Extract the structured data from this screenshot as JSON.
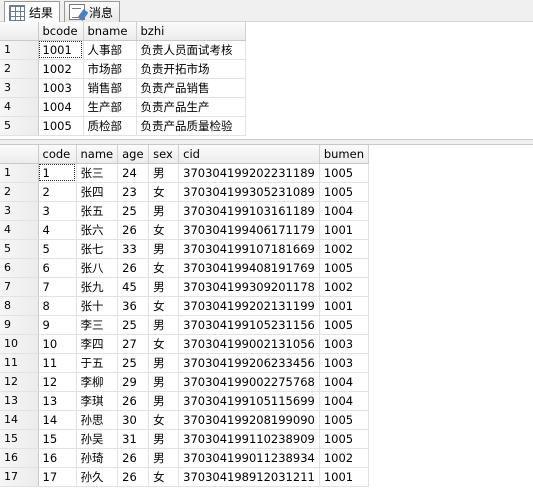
{
  "tabs": [
    {
      "label": "结果",
      "icon": "grid-icon",
      "active": true
    },
    {
      "label": "消息",
      "icon": "messages-icon",
      "active": false
    }
  ],
  "departments": {
    "columns": [
      "bcode",
      "bname",
      "bzhi"
    ],
    "rows": [
      [
        "1001",
        "人事部",
        "负责人员面试考核"
      ],
      [
        "1002",
        "市场部",
        "负责开拓市场"
      ],
      [
        "1003",
        "销售部",
        "负责产品销售"
      ],
      [
        "1004",
        "生产部",
        "负责产品生产"
      ],
      [
        "1005",
        "质检部",
        "负责产品质量检验"
      ]
    ]
  },
  "employees": {
    "columns": [
      "code",
      "name",
      "age",
      "sex",
      "cid",
      "bumen"
    ],
    "rows": [
      [
        "1",
        "张三",
        "24",
        "男",
        "370304199202231189",
        "1005"
      ],
      [
        "2",
        "张四",
        "23",
        "女",
        "370304199305231089",
        "1005"
      ],
      [
        "3",
        "张五",
        "25",
        "男",
        "370304199103161189",
        "1004"
      ],
      [
        "4",
        "张六",
        "26",
        "女",
        "370304199406171179",
        "1001"
      ],
      [
        "5",
        "张七",
        "33",
        "男",
        "370304199107181669",
        "1002"
      ],
      [
        "6",
        "张八",
        "26",
        "女",
        "370304199408191769",
        "1005"
      ],
      [
        "7",
        "张九",
        "45",
        "男",
        "370304199309201178",
        "1002"
      ],
      [
        "8",
        "张十",
        "36",
        "女",
        "370304199202131199",
        "1001"
      ],
      [
        "9",
        "李三",
        "25",
        "男",
        "370304199105231156",
        "1005"
      ],
      [
        "10",
        "李四",
        "27",
        "女",
        "370304199002131056",
        "1003"
      ],
      [
        "11",
        "于五",
        "25",
        "男",
        "370304199206233456",
        "1003"
      ],
      [
        "12",
        "李柳",
        "29",
        "男",
        "370304199002275768",
        "1004"
      ],
      [
        "13",
        "李琪",
        "26",
        "男",
        "370304199105115699",
        "1004"
      ],
      [
        "14",
        "孙思",
        "30",
        "女",
        "370304199208199090",
        "1005"
      ],
      [
        "15",
        "孙吴",
        "31",
        "男",
        "370304199110238909",
        "1005"
      ],
      [
        "16",
        "孙琦",
        "26",
        "男",
        "370304199011238934",
        "1002"
      ],
      [
        "17",
        "孙久",
        "26",
        "女",
        "370304198912031211",
        "1001"
      ]
    ]
  }
}
